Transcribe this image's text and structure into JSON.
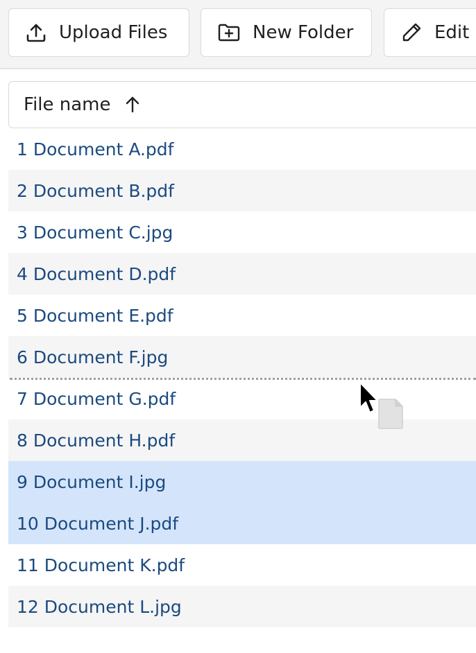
{
  "toolbar": {
    "upload_label": "Upload Files",
    "upload_icon": "upload-icon",
    "new_folder_label": "New Folder",
    "new_folder_icon": "folder-plus-icon",
    "edit_label": "Edit",
    "edit_icon": "pencil-icon"
  },
  "table": {
    "column_header": "File name",
    "sort_icon": "arrow-up-icon",
    "rows": [
      {
        "name": "1 Document A.pdf",
        "selected": false
      },
      {
        "name": "2 Document B.pdf",
        "selected": false
      },
      {
        "name": "3 Document C.jpg",
        "selected": false
      },
      {
        "name": "4 Document D.pdf",
        "selected": false
      },
      {
        "name": "5 Document E.pdf",
        "selected": false
      },
      {
        "name": "6 Document F.jpg",
        "selected": false
      },
      {
        "name": "7 Document G.pdf",
        "selected": false
      },
      {
        "name": "8 Document H.pdf",
        "selected": false
      },
      {
        "name": "9 Document I.jpg",
        "selected": true
      },
      {
        "name": "10 Document J.pdf",
        "selected": true
      },
      {
        "name": "11 Document K.pdf",
        "selected": false
      },
      {
        "name": "12 Document L.jpg",
        "selected": false
      }
    ]
  },
  "drag": {
    "cursor_icon": "arrow-cursor-icon",
    "ghost_icon": "file-icon"
  },
  "colors": {
    "link": "#1b4a80",
    "selected_row": "#d4e5fb",
    "alt_row": "#f5f5f5",
    "toolbar_bg": "#f4f4f4"
  }
}
